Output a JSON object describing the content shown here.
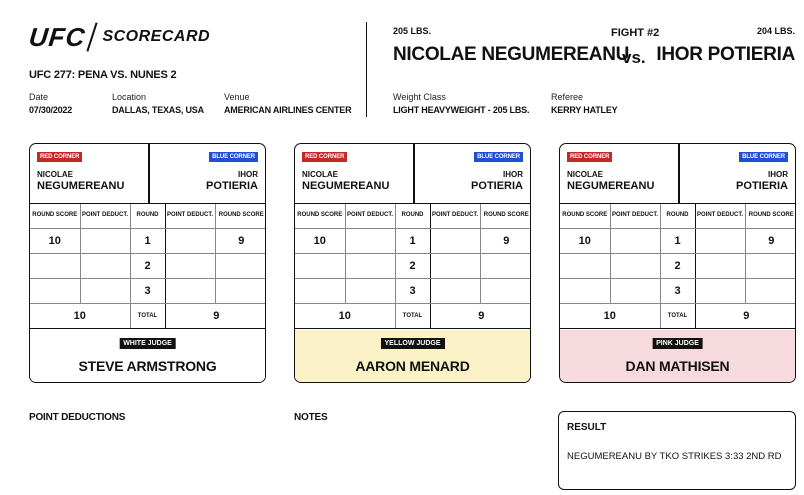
{
  "header": {
    "logo_text": "UFC",
    "logo_subtitle": "SCORECARD",
    "event": "UFC 277: PENA VS. NUNES 2",
    "date_label": "Date",
    "date": "07/30/2022",
    "location_label": "Location",
    "location": "DALLAS, TEXAS, USA",
    "venue_label": "Venue",
    "venue": "AMERICAN AIRLINES CENTER",
    "weight_class_label": "Weight Class",
    "weight_class": "LIGHT HEAVYWEIGHT - 205 LBS.",
    "referee_label": "Referee",
    "referee": "KERRY HATLEY"
  },
  "fight": {
    "number": "FIGHT #2",
    "vs": "vs.",
    "red": {
      "weight": "205 LBS.",
      "name": "NICOLAE NEGUMEREANU",
      "first": "NICOLAE",
      "last": "NEGUMEREANU"
    },
    "blue": {
      "weight": "204 LBS.",
      "name": "IHOR POTIERIA",
      "first": "IHOR",
      "last": "POTIERIA"
    }
  },
  "labels": {
    "red_corner": "RED CORNER",
    "blue_corner": "BLUE CORNER",
    "round_score": "ROUND SCORE",
    "point_deduct": "POINT DEDUCT.",
    "round": "ROUND",
    "total": "TOTAL",
    "point_deductions": "POINT DEDUCTIONS",
    "notes": "NOTES",
    "result": "RESULT"
  },
  "colors": {
    "red_corner": "#c62828",
    "blue_corner": "#1e4fd8",
    "yellow_judge_bg": "#fbf3c7",
    "pink_judge_bg": "#f6dadd"
  },
  "cards": [
    {
      "judge_label": "WHITE JUDGE",
      "judge_name": "STEVE ARMSTRONG",
      "judge_bg": "#ffffff",
      "rounds": [
        {
          "round": "1",
          "red_score": "10",
          "red_deduct": "",
          "blue_deduct": "",
          "blue_score": "9"
        },
        {
          "round": "2",
          "red_score": "",
          "red_deduct": "",
          "blue_deduct": "",
          "blue_score": ""
        },
        {
          "round": "3",
          "red_score": "",
          "red_deduct": "",
          "blue_deduct": "",
          "blue_score": ""
        }
      ],
      "red_total": "10",
      "blue_total": "9"
    },
    {
      "judge_label": "YELLOW JUDGE",
      "judge_name": "AARON MENARD",
      "judge_bg": "#fbf3c7",
      "rounds": [
        {
          "round": "1",
          "red_score": "10",
          "red_deduct": "",
          "blue_deduct": "",
          "blue_score": "9"
        },
        {
          "round": "2",
          "red_score": "",
          "red_deduct": "",
          "blue_deduct": "",
          "blue_score": ""
        },
        {
          "round": "3",
          "red_score": "",
          "red_deduct": "",
          "blue_deduct": "",
          "blue_score": ""
        }
      ],
      "red_total": "10",
      "blue_total": "9"
    },
    {
      "judge_label": "PINK JUDGE",
      "judge_name": "DAN MATHISEN",
      "judge_bg": "#f6dadd",
      "rounds": [
        {
          "round": "1",
          "red_score": "10",
          "red_deduct": "",
          "blue_deduct": "",
          "blue_score": "9"
        },
        {
          "round": "2",
          "red_score": "",
          "red_deduct": "",
          "blue_deduct": "",
          "blue_score": ""
        },
        {
          "round": "3",
          "red_score": "",
          "red_deduct": "",
          "blue_deduct": "",
          "blue_score": ""
        }
      ],
      "red_total": "10",
      "blue_total": "9"
    }
  ],
  "result": {
    "text": "NEGUMEREANU BY TKO STRIKES 3:33 2ND RD"
  }
}
